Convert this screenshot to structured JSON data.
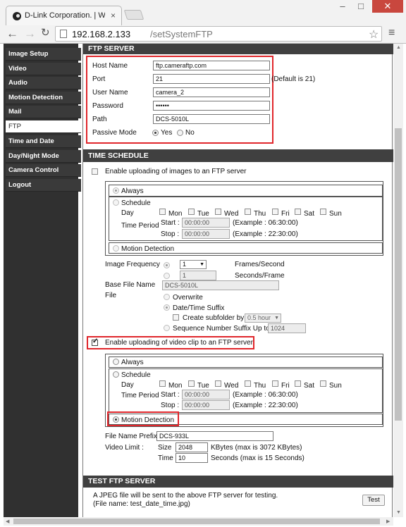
{
  "browser": {
    "tab_title": "D-Link Corporation. | WIR",
    "tab_close": "×",
    "url_host": "192.168.2.133",
    "url_path": "/setSystemFTP",
    "nav_back": "←",
    "nav_forward": "→",
    "nav_reload": "↻",
    "bookmark": "☆",
    "menu": "≡",
    "min": "–",
    "max": "□",
    "close": "✕"
  },
  "sidebar": {
    "items": [
      {
        "label": "Image Setup",
        "active": false
      },
      {
        "label": "Video",
        "active": false
      },
      {
        "label": "Audio",
        "active": false
      },
      {
        "label": "Motion Detection",
        "active": false
      },
      {
        "label": "Mail",
        "active": false
      },
      {
        "label": "FTP",
        "active": true
      },
      {
        "label": "Time and Date",
        "active": false
      },
      {
        "label": "Day/Night Mode",
        "active": false
      },
      {
        "label": "Camera Control",
        "active": false
      },
      {
        "label": "Logout",
        "active": false
      }
    ]
  },
  "ftp_server": {
    "title": "FTP SERVER",
    "host_label": "Host Name",
    "host_value": "ftp.cameraftp.com",
    "port_label": "Port",
    "port_value": "21",
    "port_hint": "(Default is 21)",
    "user_label": "User Name",
    "user_value": "camera_2",
    "password_label": "Password",
    "password_value": "••••••",
    "path_label": "Path",
    "path_value": "DCS-5010L",
    "passive_label": "Passive Mode",
    "passive_yes": "Yes",
    "passive_no": "No",
    "passive_selected": "Yes"
  },
  "time_schedule": {
    "title": "TIME SCHEDULE",
    "images": {
      "enable_label": "Enable uploading of images to an FTP server",
      "enabled": false,
      "always": "Always",
      "schedule": "Schedule",
      "day_label": "Day",
      "days": [
        "Mon",
        "Tue",
        "Wed",
        "Thu",
        "Fri",
        "Sat",
        "Sun"
      ],
      "time_period": "Time Period",
      "start_label": "Start :",
      "start_value": "00:00:00",
      "start_example": "(Example : 06:30:00)",
      "stop_label": "Stop :",
      "stop_value": "00:00:00",
      "stop_example": "(Example : 22:30:00)",
      "motion": "Motion Detection",
      "frequency_label": "Image Frequency",
      "freq_value": "1",
      "freq_unit": "Frames/Second",
      "seconds_value": "1",
      "seconds_unit": "Seconds/Frame",
      "base_label": "Base File Name",
      "base_value": "DCS-5010L",
      "file_label": "File",
      "overwrite": "Overwrite",
      "datetime": "Date/Time Suffix",
      "subfolder": "Create subfolder by",
      "subfolder_value": "0.5 hour",
      "sequence": "Sequence Number Suffix Up to",
      "sequence_value": "1024"
    },
    "video": {
      "enable_label": "Enable uploading of video clip to an FTP server",
      "enabled": true,
      "always": "Always",
      "schedule": "Schedule",
      "day_label": "Day",
      "days": [
        "Mon",
        "Tue",
        "Wed",
        "Thu",
        "Fri",
        "Sat",
        "Sun"
      ],
      "time_period": "Time Period",
      "start_label": "Start :",
      "start_value": "00:00:00",
      "start_example": "(Example : 06:30:00)",
      "stop_label": "Stop :",
      "stop_value": "00:00:00",
      "stop_example": "(Example : 22:30:00)",
      "motion": "Motion Detection",
      "selected": "Motion Detection",
      "prefix_label": "File Name Prefix",
      "prefix_value": "DCS-933L",
      "limit_label": "Video Limit :",
      "size_label": "Size",
      "size_value": "2048",
      "size_unit": "KBytes (max is 3072 KBytes)",
      "time_label": "Time",
      "time_value": "10",
      "time_unit": "Seconds (max is 15 Seconds)"
    }
  },
  "test_ftp": {
    "title": "TEST FTP SERVER",
    "line1": "A JPEG file will be sent to the above FTP server for testing.",
    "line2": "(File name: test_date_time.jpg)",
    "button": "Test"
  },
  "colors": {
    "sidebar_bg": "#303030",
    "section_header": "#404040",
    "highlight": "#e0262b",
    "close_button": "#c9473e"
  }
}
